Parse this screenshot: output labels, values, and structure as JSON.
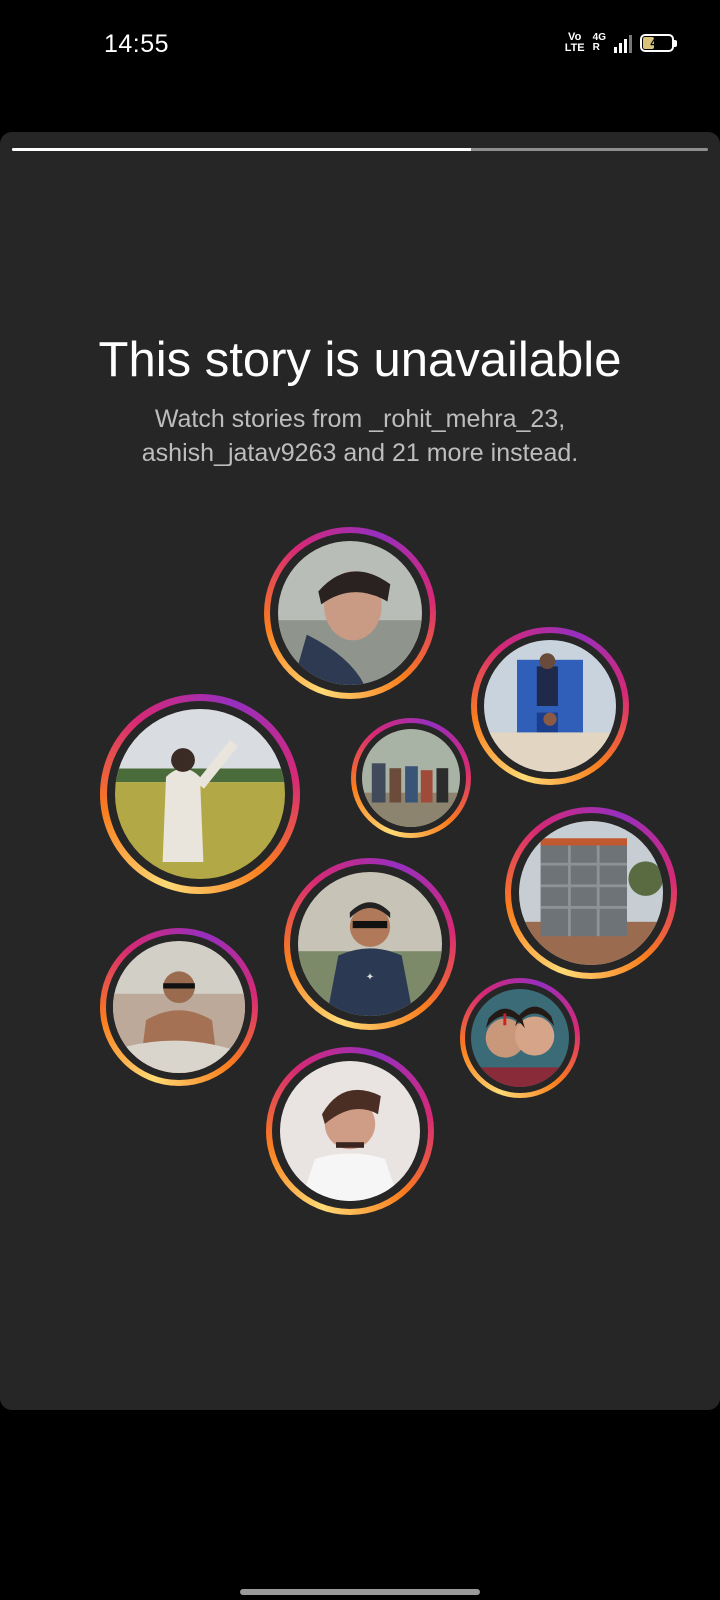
{
  "status_bar": {
    "time": "14:55",
    "volte_top": "Vo",
    "volte_bottom": "LTE",
    "network": "4G",
    "network_sub": "R",
    "battery": "42"
  },
  "story": {
    "progress": 0.66,
    "title": "This story is unavailable",
    "subtitle": "Watch stories from _rohit_mehra_23, ashish_jatav9263 and 21 more instead."
  },
  "ring_colors": [
    "#feda75",
    "#fa7e1e",
    "#d62976",
    "#962fbf"
  ],
  "accent": "#262626"
}
